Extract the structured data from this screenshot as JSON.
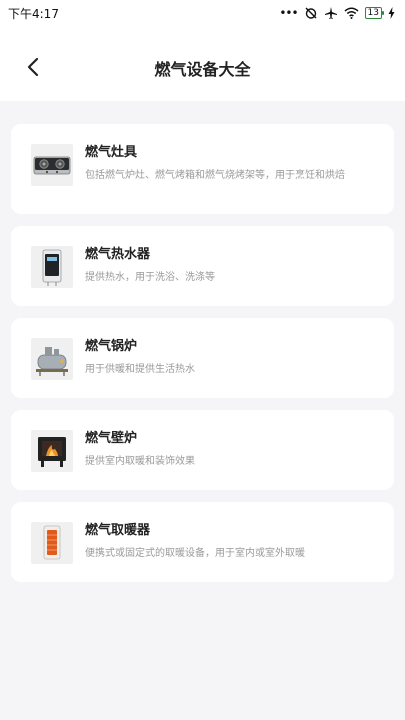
{
  "status_bar": {
    "time": "下午4:17",
    "dots": "•••",
    "battery": "13"
  },
  "header": {
    "title": "燃气设备大全"
  },
  "items": [
    {
      "title": "燃气灶具",
      "desc": "包括燃气炉灶、燃气烤箱和燃气烧烤架等，用于烹饪和烘焙"
    },
    {
      "title": "燃气热水器",
      "desc": "提供热水，用于洗浴、洗涤等"
    },
    {
      "title": "燃气锅炉",
      "desc": "用于供暖和提供生活热水"
    },
    {
      "title": "燃气壁炉",
      "desc": "提供室内取暖和装饰效果"
    },
    {
      "title": "燃气取暖器",
      "desc": "便携式或固定式的取暖设备，用于室内或室外取暖"
    }
  ]
}
